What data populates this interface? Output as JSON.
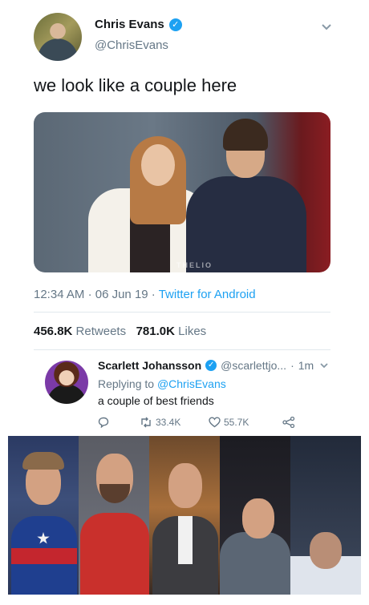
{
  "tweet": {
    "author_name": "Chris Evans",
    "author_handle": "@ChrisEvans",
    "text": "we look like a couple here",
    "photo_watermark": "THELIO",
    "time": "12:34 AM",
    "date": "06 Jun 19",
    "client": "Twitter for Android",
    "retweets_count": "456.8K",
    "retweets_label": "Retweets",
    "likes_count": "781.0K",
    "likes_label": "Likes",
    "verified_icon": "verified-badge-icon",
    "menu_icon": "chevron-down-icon"
  },
  "reply": {
    "author_name": "Scarlett Johansson",
    "author_handle": "@scarlettjo...",
    "age": "1m",
    "replying_prefix": "Replying to",
    "replying_to": "@ChrisEvans",
    "text": "a couple of best friends",
    "retweets": "33.4K",
    "likes": "55.7K",
    "icons": [
      "reply-icon",
      "retweet-icon",
      "heart-icon",
      "share-icon"
    ]
  },
  "colors": {
    "accent": "#1da1f2",
    "muted_text": "#657786",
    "text": "#14171a"
  }
}
